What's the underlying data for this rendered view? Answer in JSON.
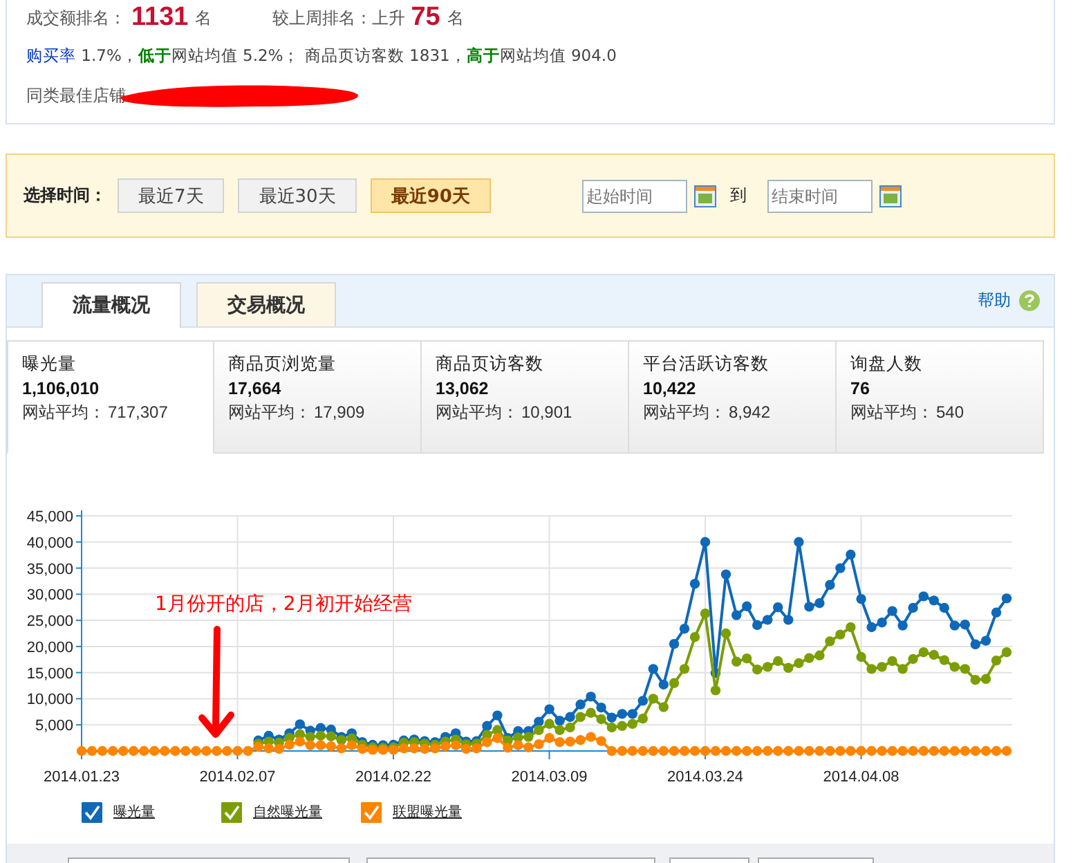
{
  "summary": {
    "rank_label": "成交额排名：",
    "rank_value": "1131",
    "rank_unit": "名",
    "change_label": "较上周排名：上升",
    "change_value": "75",
    "change_unit": "名",
    "sentence": [
      {
        "kind": "link",
        "text": "购买率"
      },
      {
        "kind": "plain",
        "text": " 1.7%，"
      },
      {
        "kind": "low",
        "text": "低于"
      },
      {
        "kind": "plain",
        "text": "网站均值 5.2%； 商品页访客数 1831，"
      },
      {
        "kind": "high",
        "text": "高于"
      },
      {
        "kind": "plain",
        "text": "网站均值 904.0"
      }
    ],
    "best_store_label": "同类最佳店铺"
  },
  "time_filter": {
    "label": "选择时间：",
    "ranges": [
      {
        "label": "最近7天",
        "selected": false
      },
      {
        "label": "最近30天",
        "selected": false
      },
      {
        "label": "最近90天",
        "selected": true
      }
    ],
    "start_placeholder": "起始时间",
    "to": "到",
    "end_placeholder": "结束时间"
  },
  "tabs": [
    {
      "label": "流量概况",
      "selected": true
    },
    {
      "label": "交易概况",
      "selected": false
    }
  ],
  "help": "帮助",
  "metrics": [
    {
      "name": "曝光量",
      "value": "1,106,010",
      "avg_label": "网站平均：",
      "avg": "717,307",
      "selected": true
    },
    {
      "name": "商品页浏览量",
      "value": "17,664",
      "avg_label": "网站平均：",
      "avg": "17,909",
      "selected": false
    },
    {
      "name": "商品页访客数",
      "value": "13,062",
      "avg_label": "网站平均：",
      "avg": "10,901",
      "selected": false
    },
    {
      "name": "平台活跃访客数",
      "value": "10,422",
      "avg_label": "网站平均：",
      "avg": "8,942",
      "selected": false
    },
    {
      "name": "询盘人数",
      "value": "76",
      "avg_label": "网站平均：",
      "avg": "540",
      "selected": false
    }
  ],
  "chart_data": {
    "type": "line",
    "grid": true,
    "ylim": [
      0,
      45000
    ],
    "yticks": [
      {
        "value": 5000,
        "label": "5,000"
      },
      {
        "value": 10000,
        "label": "10,000"
      },
      {
        "value": 15000,
        "label": "15,000"
      },
      {
        "value": 20000,
        "label": "20,000"
      },
      {
        "value": 25000,
        "label": "25,000"
      },
      {
        "value": 30000,
        "label": "30,000"
      },
      {
        "value": 35000,
        "label": "35,000"
      },
      {
        "value": 40000,
        "label": "40,000"
      },
      {
        "value": 45000,
        "label": "45,000"
      }
    ],
    "categories": [
      "2014.01.23",
      null,
      null,
      null,
      null,
      null,
      null,
      null,
      null,
      null,
      null,
      null,
      null,
      null,
      null,
      "2014.02.07",
      null,
      null,
      null,
      null,
      null,
      null,
      null,
      null,
      null,
      null,
      null,
      null,
      null,
      null,
      "2014.02.22",
      null,
      null,
      null,
      null,
      null,
      null,
      null,
      null,
      null,
      null,
      null,
      null,
      null,
      null,
      "2014.03.09",
      null,
      null,
      null,
      null,
      null,
      null,
      null,
      null,
      null,
      null,
      null,
      null,
      null,
      null,
      "2014.03.24",
      null,
      null,
      null,
      null,
      null,
      null,
      null,
      null,
      null,
      null,
      null,
      null,
      null,
      null,
      "2014.04.08",
      null,
      null,
      null,
      null,
      null,
      null,
      null,
      null,
      null,
      null,
      null,
      null,
      null,
      null
    ],
    "annotations": [
      "1月份开的店，2月初开始经营"
    ],
    "series": [
      {
        "name": "曝光量",
        "color": "#0f69b8",
        "marker": "circle",
        "values": [
          null,
          null,
          null,
          null,
          null,
          null,
          null,
          null,
          null,
          null,
          null,
          null,
          null,
          null,
          null,
          null,
          null,
          2000,
          2900,
          2200,
          3400,
          5100,
          3900,
          4400,
          4100,
          2700,
          3400,
          1700,
          1200,
          1100,
          1200,
          2000,
          2200,
          1900,
          1700,
          2700,
          3400,
          1800,
          1900,
          4800,
          6800,
          2500,
          3800,
          3800,
          5600,
          8000,
          5800,
          6500,
          8900,
          10400,
          8300,
          6400,
          7100,
          7100,
          9600,
          15700,
          12700,
          20500,
          23400,
          32000,
          40000,
          14900,
          33800,
          26000,
          27700,
          24100,
          25100,
          27500,
          25100,
          40000,
          27600,
          28300,
          31800,
          35000,
          37600,
          29100,
          23700,
          24600,
          26800,
          24000,
          27400,
          29600,
          28800,
          27400,
          24000,
          24200,
          20400,
          21100,
          26500,
          29200
        ]
      },
      {
        "name": "自然曝光量",
        "color": "#7c9e05",
        "marker": "circle",
        "values": [
          null,
          null,
          null,
          null,
          null,
          null,
          null,
          null,
          null,
          null,
          null,
          null,
          null,
          null,
          null,
          null,
          null,
          1400,
          1800,
          1600,
          2500,
          3200,
          2700,
          2900,
          2800,
          2100,
          2400,
          1200,
          700,
          600,
          700,
          1600,
          1700,
          1400,
          1200,
          1800,
          2200,
          1300,
          1400,
          3100,
          4000,
          2000,
          2600,
          2700,
          4000,
          5200,
          4000,
          4500,
          6500,
          7300,
          6100,
          4500,
          4800,
          5200,
          6200,
          10000,
          8400,
          13000,
          15700,
          21800,
          26300,
          11600,
          22500,
          17100,
          17700,
          15600,
          16100,
          17200,
          15900,
          16800,
          17800,
          18300,
          21000,
          22300,
          23700,
          18000,
          15700,
          16100,
          17200,
          15700,
          17600,
          18900,
          18400,
          17400,
          16100,
          15700,
          13600,
          13800,
          17300,
          18900
        ]
      },
      {
        "name": "联盟曝光量",
        "color": "#ff8400",
        "marker": "circle",
        "values": [
          0,
          0,
          0,
          0,
          0,
          0,
          0,
          0,
          0,
          0,
          0,
          0,
          0,
          0,
          0,
          0,
          0,
          800,
          500,
          400,
          1200,
          1800,
          1100,
          1100,
          900,
          500,
          1100,
          400,
          200,
          200,
          200,
          500,
          500,
          400,
          500,
          900,
          1100,
          400,
          500,
          1700,
          2500,
          600,
          1100,
          700,
          1300,
          2500,
          1700,
          1800,
          2100,
          2700,
          1900,
          0,
          0,
          0,
          0,
          0,
          0,
          0,
          0,
          0,
          0,
          0,
          0,
          0,
          0,
          0,
          0,
          0,
          0,
          0,
          0,
          0,
          0,
          0,
          0,
          0,
          0,
          0,
          0,
          0,
          0,
          0,
          0,
          0,
          0,
          0,
          0,
          0,
          0,
          0
        ]
      }
    ]
  },
  "legend": [
    {
      "checked": true
    },
    {
      "checked": true
    },
    {
      "checked": true
    }
  ]
}
